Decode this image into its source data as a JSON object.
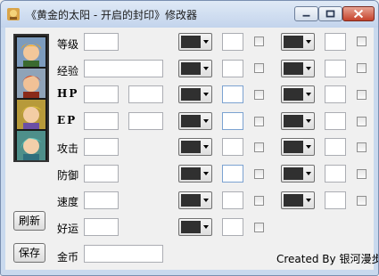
{
  "window": {
    "title": "《黄金的太阳 - 开启的封印》修改器"
  },
  "titlebar_buttons": [
    "minimize",
    "maximize",
    "close"
  ],
  "rows": [
    {
      "label": "等级",
      "value": "",
      "bold": false
    },
    {
      "label": "经验",
      "value": "",
      "bold": false
    },
    {
      "label": "HP",
      "value": "",
      "value2": "",
      "bold": true
    },
    {
      "label": "EP",
      "value": "",
      "value2": "",
      "bold": true
    },
    {
      "label": "攻击",
      "value": "",
      "bold": false
    },
    {
      "label": "防御",
      "value": "",
      "bold": false
    },
    {
      "label": "速度",
      "value": "",
      "bold": false
    },
    {
      "label": "好运",
      "value": "",
      "bold": false
    },
    {
      "label": "金币",
      "value": "",
      "bold": false
    }
  ],
  "buttons": {
    "refresh": "刷新",
    "save": "保存"
  },
  "credit": "Created By 银河漫步",
  "colors": {
    "swatch": "#303030",
    "titlebar": "#c9d9ee"
  },
  "portraits": [
    "portrait-1",
    "portrait-2",
    "portrait-3",
    "portrait-4"
  ]
}
